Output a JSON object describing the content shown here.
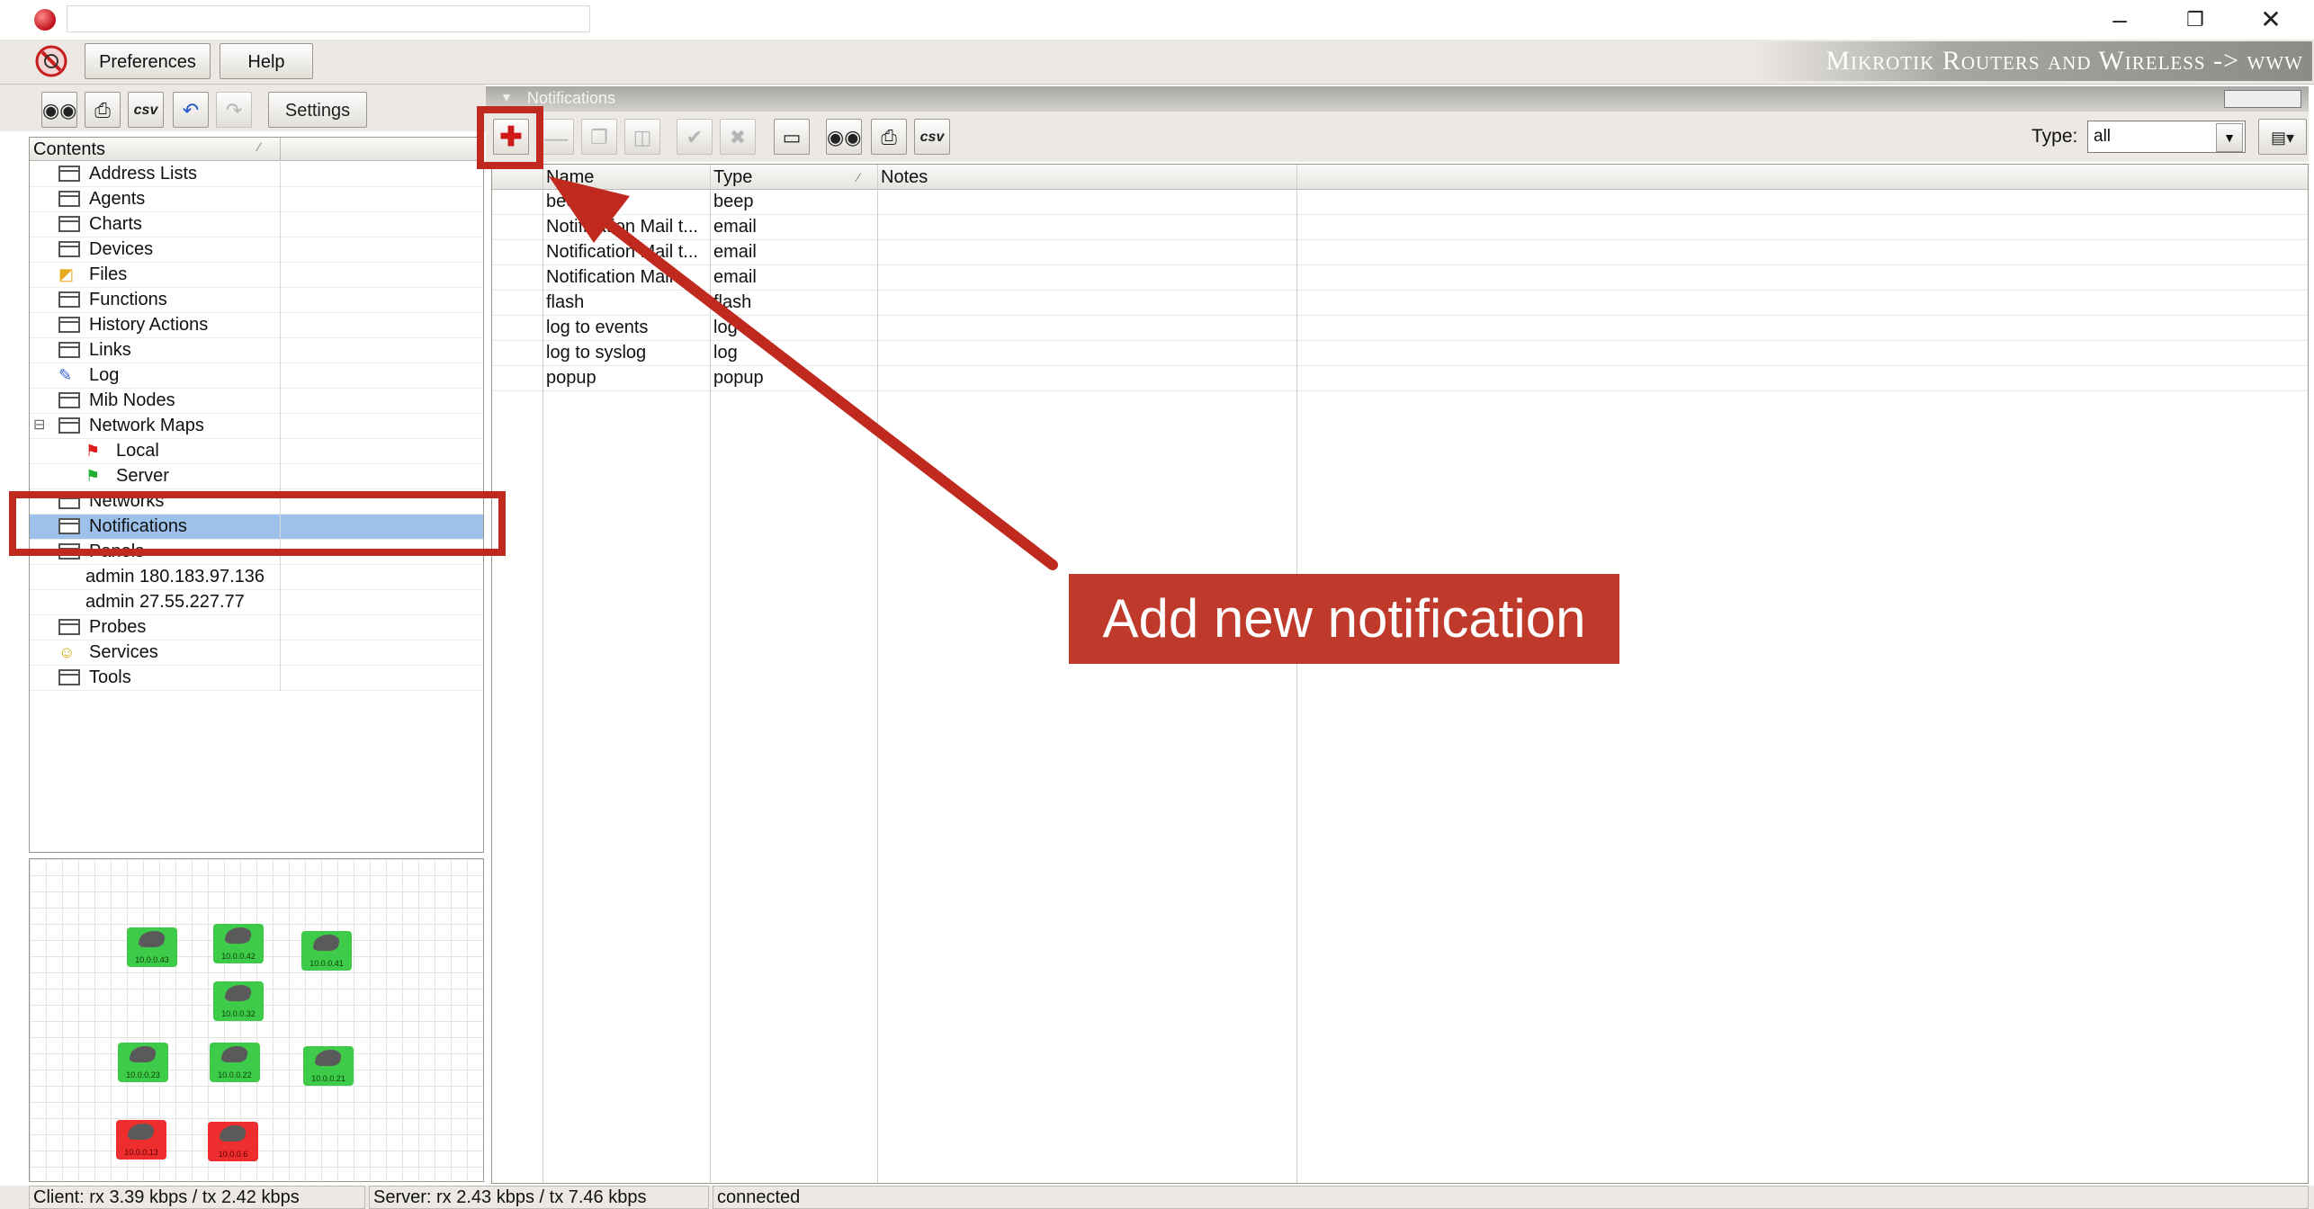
{
  "menu": {
    "preferences": "Preferences",
    "help": "Help"
  },
  "brand": "Mikrotik Routers and Wireless -> www",
  "left_toolbar": {
    "settings": "Settings",
    "csv": "csv"
  },
  "tree": {
    "header": "Contents",
    "items": [
      {
        "label": "Address Lists",
        "icon": "table-icon"
      },
      {
        "label": "Agents",
        "icon": "table-icon"
      },
      {
        "label": "Charts",
        "icon": "table-icon"
      },
      {
        "label": "Devices",
        "icon": "table-icon"
      },
      {
        "label": "Files",
        "icon": "files-icon"
      },
      {
        "label": "Functions",
        "icon": "table-icon"
      },
      {
        "label": "History Actions",
        "icon": "table-icon"
      },
      {
        "label": "Links",
        "icon": "table-icon"
      },
      {
        "label": "Log",
        "icon": "log-icon"
      },
      {
        "label": "Mib Nodes",
        "icon": "table-icon"
      },
      {
        "label": "Network Maps",
        "icon": "table-icon"
      },
      {
        "label": "Local",
        "icon": "red-flag-icon"
      },
      {
        "label": "Server",
        "icon": "green-flag-icon"
      },
      {
        "label": "Networks",
        "icon": "table-icon"
      },
      {
        "label": "Notifications",
        "icon": "table-icon"
      },
      {
        "label": "Panels",
        "icon": "table-icon"
      },
      {
        "label": "admin 180.183.97.136",
        "icon": ""
      },
      {
        "label": "admin 27.55.227.77",
        "icon": ""
      },
      {
        "label": "Probes",
        "icon": "table-icon"
      },
      {
        "label": "Services",
        "icon": "services-icon"
      },
      {
        "label": "Tools",
        "icon": "table-icon"
      }
    ]
  },
  "map_nodes": [
    {
      "label": "10.0.0.43",
      "status": "up"
    },
    {
      "label": "10.0.0.42",
      "status": "up"
    },
    {
      "label": "10.0.0.41",
      "status": "up"
    },
    {
      "label": "10.0.0.32",
      "status": "up"
    },
    {
      "label": "10.0.0.23",
      "status": "up"
    },
    {
      "label": "10.0.0.22",
      "status": "up"
    },
    {
      "label": "10.0.0.21",
      "status": "up"
    },
    {
      "label": "10.0.0.13",
      "status": "down"
    },
    {
      "label": "10.0.0.6",
      "status": "down"
    }
  ],
  "panel": {
    "title": "Notifications",
    "type_label": "Type:",
    "type_value": "all",
    "columns": [
      "Name",
      "Type",
      "Notes"
    ],
    "rows": [
      {
        "name": "beep",
        "type": "beep",
        "notes": ""
      },
      {
        "name": "Notification Mail t...",
        "type": "email",
        "notes": ""
      },
      {
        "name": "Notification Mail t...",
        "type": "email",
        "notes": ""
      },
      {
        "name": "Notification Mail",
        "type": "email",
        "notes": ""
      },
      {
        "name": "flash",
        "type": "flash",
        "notes": ""
      },
      {
        "name": "log to events",
        "type": "log",
        "notes": ""
      },
      {
        "name": "log to syslog",
        "type": "log",
        "notes": ""
      },
      {
        "name": "popup",
        "type": "popup",
        "notes": ""
      }
    ]
  },
  "status": {
    "client": "Client: rx 3.39 kbps / tx 2.42 kbps",
    "server": "Server: rx 2.43 kbps / tx 7.46 kbps",
    "connection": "connected"
  },
  "annotation": {
    "callout": "Add new notification"
  },
  "colors": {
    "highlight": "#c0291d",
    "selection": "#9cc1ea",
    "node_up": "#3ecb49",
    "node_down": "#ee2e2e"
  }
}
